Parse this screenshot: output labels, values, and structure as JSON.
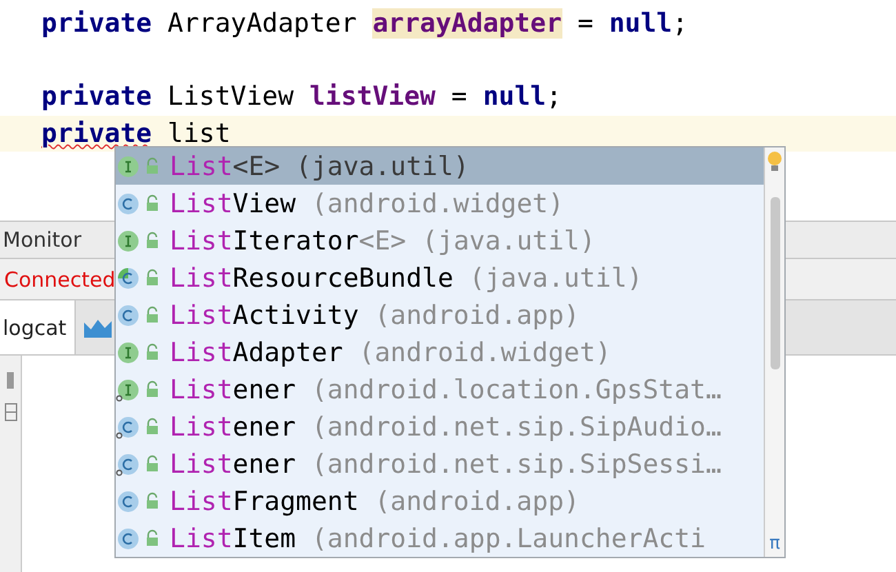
{
  "editor": {
    "lines": [
      {
        "current": false,
        "tokens": [
          {
            "text": "private",
            "kind": "keyword"
          },
          {
            "text": " ArrayAdapter ",
            "kind": "plain"
          },
          {
            "text": "arrayAdapter",
            "kind": "field",
            "highlighted": true
          },
          {
            "text": " = ",
            "kind": "plain"
          },
          {
            "text": "null",
            "kind": "keyword"
          },
          {
            "text": ";",
            "kind": "plain"
          }
        ]
      },
      {
        "current": false
      },
      {
        "current": false,
        "tokens": [
          {
            "text": "private",
            "kind": "keyword"
          },
          {
            "text": " ListView ",
            "kind": "plain"
          },
          {
            "text": "listView",
            "kind": "field",
            "highlighted": false
          },
          {
            "text": " = ",
            "kind": "plain"
          },
          {
            "text": "null",
            "kind": "keyword"
          },
          {
            "text": ";",
            "kind": "plain"
          }
        ]
      },
      {
        "current": true,
        "tokens": [
          {
            "text": "private",
            "kind": "keyword",
            "error": true
          },
          {
            "text": " list",
            "kind": "plain"
          }
        ]
      }
    ]
  },
  "tool_window": {
    "title": "Monitor",
    "status": "Connected",
    "tabs": [
      {
        "label": "logcat",
        "selected": true
      }
    ]
  },
  "completion": {
    "corner_symbol": "π",
    "items": [
      {
        "kind": "interface",
        "nested": false,
        "selected": true,
        "match": "List",
        "generic": "<E>",
        "package": "(java.util)"
      },
      {
        "kind": "class",
        "nested": false,
        "selected": false,
        "match": "List",
        "rest": "View",
        "package": "(android.widget)"
      },
      {
        "kind": "interface",
        "nested": false,
        "selected": false,
        "match": "List",
        "rest": "Iterator",
        "generic": "<E>",
        "package": "(java.util)"
      },
      {
        "kind": "abstract",
        "nested": false,
        "selected": false,
        "match": "List",
        "rest": "ResourceBundle",
        "package": "(java.util)"
      },
      {
        "kind": "class",
        "nested": false,
        "selected": false,
        "match": "List",
        "rest": "Activity",
        "package": "(android.app)"
      },
      {
        "kind": "interface",
        "nested": false,
        "selected": false,
        "match": "List",
        "rest": "Adapter",
        "package": "(android.widget)"
      },
      {
        "kind": "interface",
        "nested": true,
        "selected": false,
        "match": "List",
        "rest": "ener",
        "package": "(android.location.GpsStat…"
      },
      {
        "kind": "class",
        "nested": true,
        "selected": false,
        "match": "List",
        "rest": "ener",
        "package": "(android.net.sip.SipAudio…"
      },
      {
        "kind": "class",
        "nested": true,
        "selected": false,
        "match": "List",
        "rest": "ener",
        "package": "(android.net.sip.SipSessi…"
      },
      {
        "kind": "class",
        "nested": false,
        "selected": false,
        "match": "List",
        "rest": "Fragment",
        "package": "(android.app)"
      },
      {
        "kind": "class",
        "nested": false,
        "selected": false,
        "match": "List",
        "rest": "Item",
        "package": "(android.app.LauncherActi"
      }
    ]
  }
}
